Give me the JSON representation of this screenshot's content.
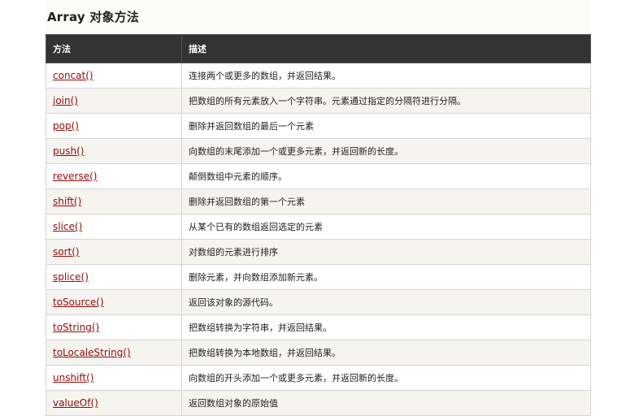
{
  "title": "Array 对象方法",
  "table": {
    "headers": [
      "方法",
      "描述"
    ],
    "rows": [
      {
        "method": "concat()",
        "desc": "连接两个或更多的数组，并返回结果。"
      },
      {
        "method": "join()",
        "desc": "把数组的所有元素放入一个字符串。元素通过指定的分隔符进行分隔。"
      },
      {
        "method": "pop()",
        "desc": "删除并返回数组的最后一个元素"
      },
      {
        "method": "push()",
        "desc": "向数组的末尾添加一个或更多元素，并返回新的长度。"
      },
      {
        "method": "reverse()",
        "desc": "颠倒数组中元素的顺序。"
      },
      {
        "method": "shift()",
        "desc": "删除并返回数组的第一个元素"
      },
      {
        "method": "slice()",
        "desc": "从某个已有的数组返回选定的元素"
      },
      {
        "method": "sort()",
        "desc": "对数组的元素进行排序"
      },
      {
        "method": "splice()",
        "desc": "删除元素，并向数组添加新元素。"
      },
      {
        "method": "toSource()",
        "desc": "返回该对象的源代码。"
      },
      {
        "method": "toString()",
        "desc": "把数组转换为字符串，并返回结果。"
      },
      {
        "method": "toLocaleString()",
        "desc": "把数组转换为本地数组，并返回结果。"
      },
      {
        "method": "unshift()",
        "desc": "向数组的开头添加一个或更多元素，并返回新的长度。"
      },
      {
        "method": "valueOf()",
        "desc": "返回数组对象的原始值"
      }
    ]
  },
  "colors": {
    "header_bg": "#333333",
    "link": "#900b09",
    "alt_row": "#f6f4f0"
  }
}
